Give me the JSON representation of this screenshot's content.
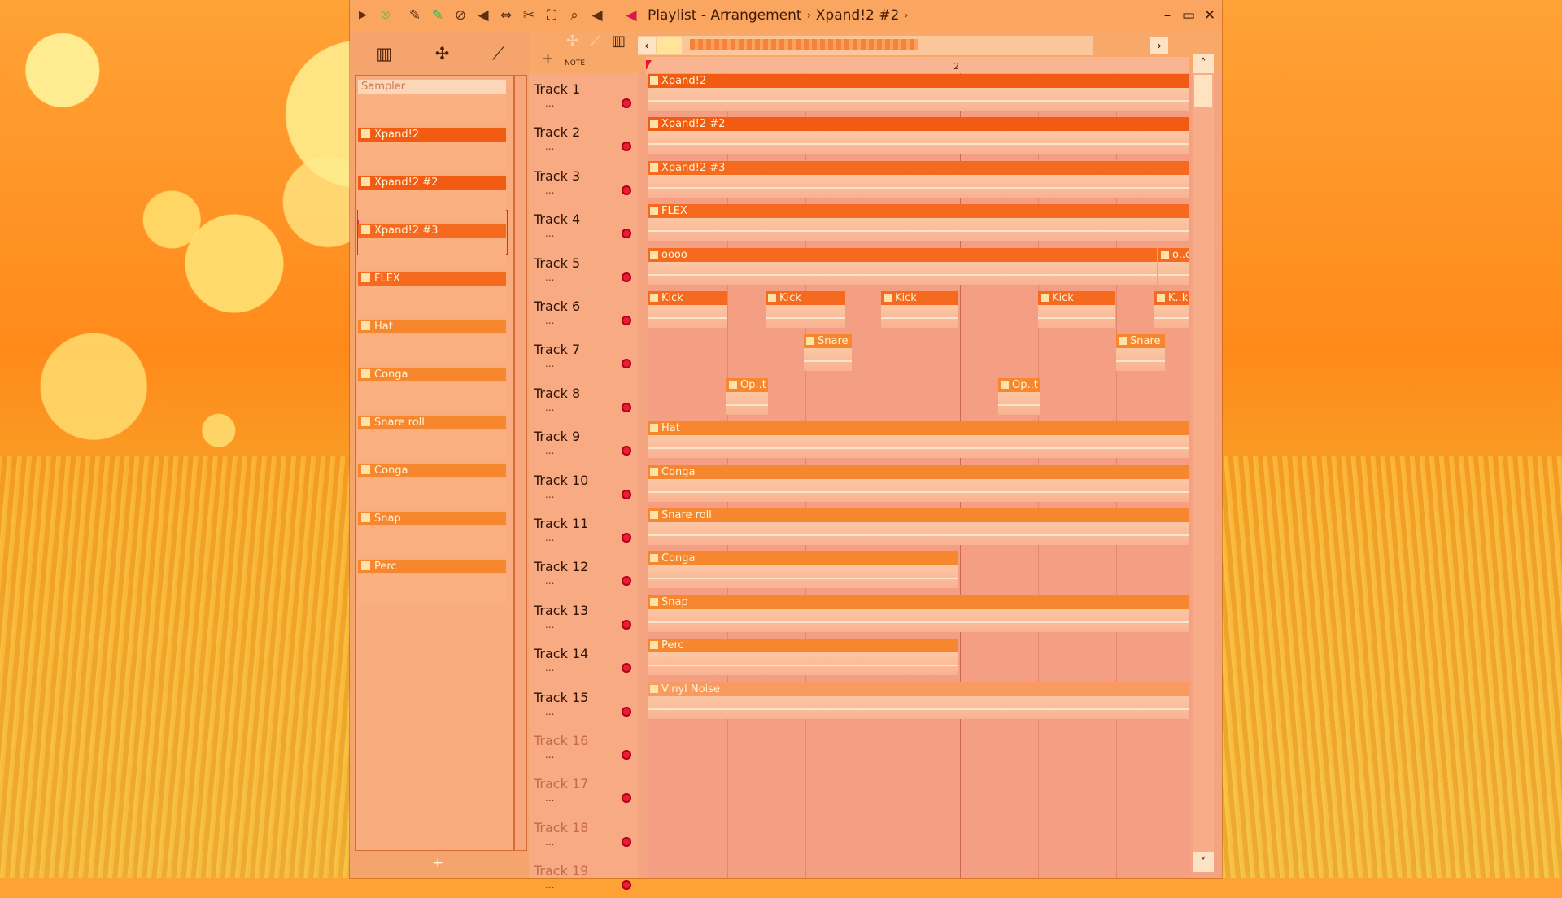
{
  "window": {
    "title": "Playlist - Arrangement",
    "current_pattern": "Xpand!2 #2",
    "title_sep": "›",
    "title_trail": "›",
    "minimize": "–",
    "maximize": "▭",
    "close": "✕"
  },
  "toolbar_icons": [
    "play-arrow-icon",
    "snap-icon",
    "pencil-icon",
    "paint-icon",
    "delete-icon",
    "mute-icon",
    "slip-icon",
    "slice-icon",
    "select-icon",
    "zoom-icon",
    "playback-icon",
    "speaker-icon"
  ],
  "browser": {
    "tabs": [
      "piano-roll-icon",
      "audio-icon",
      "automation-icon"
    ],
    "patterns": [
      {
        "label": "Sampler",
        "color": "#fbd6b8",
        "text_color": "#c97a52"
      },
      {
        "label": "Xpand!2",
        "color": "#f25b12"
      },
      {
        "label": "Xpand!2 #2",
        "color": "#f25b12"
      },
      {
        "label": "Xpand!2 #3",
        "color": "#f56a1e"
      },
      {
        "label": "FLEX",
        "color": "#f56a1e"
      },
      {
        "label": "Hat",
        "color": "#f7872f"
      },
      {
        "label": "Conga",
        "color": "#f7872f"
      },
      {
        "label": "Snare roll",
        "color": "#f7872f"
      },
      {
        "label": "Conga",
        "color": "#f7872f"
      },
      {
        "label": "Snap",
        "color": "#f7872f"
      },
      {
        "label": "Perc",
        "color": "#f7872f"
      }
    ],
    "add": "+"
  },
  "playlist": {
    "add": "+",
    "note_label": "NOTE",
    "ruler_bar": "2",
    "scroll_left": "‹",
    "scroll_right": "›",
    "scroll_up": "˄",
    "scroll_down": "˅",
    "tracks": [
      {
        "name": "Track 1"
      },
      {
        "name": "Track 2"
      },
      {
        "name": "Track 3"
      },
      {
        "name": "Track 4"
      },
      {
        "name": "Track 5"
      },
      {
        "name": "Track 6"
      },
      {
        "name": "Track 7"
      },
      {
        "name": "Track 8"
      },
      {
        "name": "Track 9"
      },
      {
        "name": "Track 10"
      },
      {
        "name": "Track 11"
      },
      {
        "name": "Track 12"
      },
      {
        "name": "Track 13"
      },
      {
        "name": "Track 14"
      },
      {
        "name": "Track 15"
      },
      {
        "name": "Track 16"
      },
      {
        "name": "Track 17"
      },
      {
        "name": "Track 18"
      },
      {
        "name": "Track 19"
      }
    ],
    "track_dots": "...",
    "clips": [
      {
        "track": 1,
        "label": "Xpand!2",
        "start": 0.0,
        "end": 1.0,
        "color": "#f25b12"
      },
      {
        "track": 2,
        "label": "Xpand!2 #2",
        "start": 0.0,
        "end": 1.0,
        "color": "#f25b12"
      },
      {
        "track": 3,
        "label": "Xpand!2 #3",
        "start": 0.0,
        "end": 1.0,
        "color": "#f56a1e"
      },
      {
        "track": 4,
        "label": "FLEX",
        "start": 0.0,
        "end": 1.0,
        "color": "#f56a1e"
      },
      {
        "track": 5,
        "label": "oooo",
        "start": 0.0,
        "end": 0.94,
        "color": "#f56a1e"
      },
      {
        "track": 5,
        "label": "o..o",
        "start": 0.94,
        "end": 1.0,
        "color": "#f56a1e"
      },
      {
        "track": 6,
        "label": "Kick",
        "start": 0.0,
        "end": 0.15,
        "color": "#f56a1e"
      },
      {
        "track": 6,
        "label": "Kick",
        "start": 0.217,
        "end": 0.367,
        "color": "#f56a1e"
      },
      {
        "track": 6,
        "label": "Kick",
        "start": 0.43,
        "end": 0.575,
        "color": "#f56a1e"
      },
      {
        "track": 6,
        "label": "Kick",
        "start": 0.718,
        "end": 0.862,
        "color": "#f56a1e"
      },
      {
        "track": 6,
        "label": "K..k",
        "start": 0.932,
        "end": 1.0,
        "color": "#f56a1e"
      },
      {
        "track": 7,
        "label": "Snare",
        "start": 0.288,
        "end": 0.38,
        "color": "#f7872f"
      },
      {
        "track": 7,
        "label": "Snare",
        "start": 0.862,
        "end": 0.955,
        "color": "#f7872f"
      },
      {
        "track": 8,
        "label": "Op..t",
        "start": 0.145,
        "end": 0.225,
        "color": "#f7872f"
      },
      {
        "track": 8,
        "label": "Op..t",
        "start": 0.645,
        "end": 0.725,
        "color": "#f7872f"
      },
      {
        "track": 9,
        "label": "Hat",
        "start": 0.0,
        "end": 1.0,
        "color": "#f7872f"
      },
      {
        "track": 10,
        "label": "Conga",
        "start": 0.0,
        "end": 1.0,
        "color": "#f7872f"
      },
      {
        "track": 11,
        "label": "Snare roll",
        "start": 0.0,
        "end": 1.0,
        "color": "#f7872f"
      },
      {
        "track": 12,
        "label": "Conga",
        "start": 0.0,
        "end": 0.575,
        "color": "#f7872f"
      },
      {
        "track": 13,
        "label": "Snap",
        "start": 0.0,
        "end": 1.0,
        "color": "#f7872f"
      },
      {
        "track": 14,
        "label": "Perc",
        "start": 0.0,
        "end": 0.575,
        "color": "#f7872f"
      },
      {
        "track": 15,
        "label": "Vinyl Noise",
        "start": 0.0,
        "end": 1.0,
        "color": "#f99a60"
      }
    ]
  }
}
